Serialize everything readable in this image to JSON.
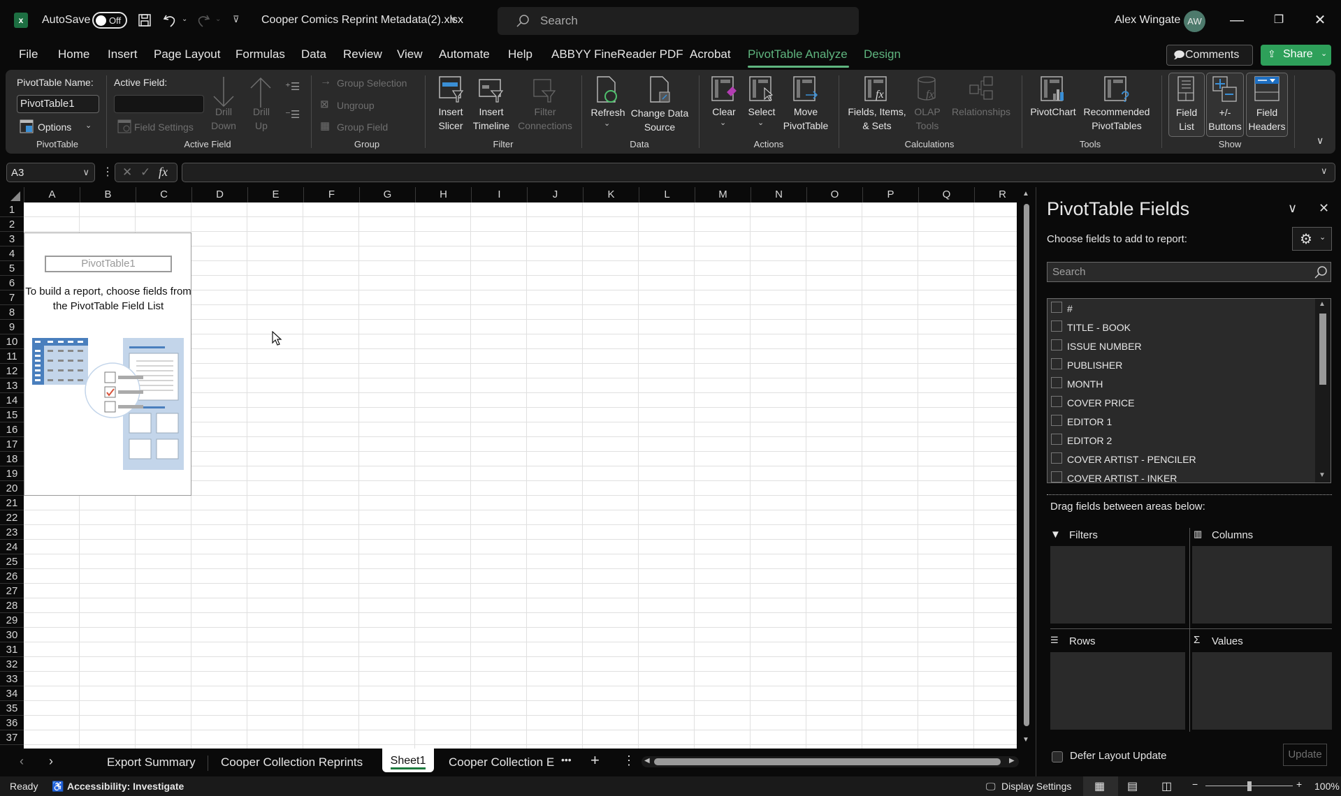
{
  "titlebar": {
    "app_icon": "excel-icon",
    "autosave_label": "AutoSave",
    "autosave_state": "Off",
    "filename": "Cooper Comics Reprint Metadata(2).xlsx",
    "search_placeholder": "Search",
    "user_name": "Alex Wingate",
    "user_initials": "AW"
  },
  "menu_tabs": [
    {
      "label": "File"
    },
    {
      "label": "Home"
    },
    {
      "label": "Insert"
    },
    {
      "label": "Page Layout"
    },
    {
      "label": "Formulas"
    },
    {
      "label": "Data"
    },
    {
      "label": "Review"
    },
    {
      "label": "View"
    },
    {
      "label": "Automate"
    },
    {
      "label": "Help"
    },
    {
      "label": "ABBYY FineReader PDF"
    },
    {
      "label": "Acrobat"
    },
    {
      "label": "PivotTable Analyze",
      "active": true
    },
    {
      "label": "Design"
    }
  ],
  "header_buttons": {
    "comments": "Comments",
    "share": "Share"
  },
  "ribbon": {
    "pivottable": {
      "name_label": "PivotTable Name:",
      "name_value": "PivotTable1",
      "options": "Options",
      "group": "PivotTable"
    },
    "active_field": {
      "label": "Active Field:",
      "value": "",
      "field_settings": "Field Settings",
      "drill_down": [
        "Drill",
        "Down"
      ],
      "drill_up": [
        "Drill",
        "Up"
      ],
      "group": "Active Field"
    },
    "group": {
      "group_selection": "Group Selection",
      "ungroup": "Ungroup",
      "group_field": "Group Field",
      "group": "Group"
    },
    "filter": {
      "insert_slicer": [
        "Insert",
        "Slicer"
      ],
      "insert_timeline": [
        "Insert",
        "Timeline"
      ],
      "filter_connections": [
        "Filter",
        "Connections"
      ],
      "group": "Filter"
    },
    "data": {
      "refresh": "Refresh",
      "change_data_source": [
        "Change Data",
        "Source"
      ],
      "group": "Data"
    },
    "actions": {
      "clear": "Clear",
      "select": "Select",
      "move_pivottable": [
        "Move",
        "PivotTable"
      ],
      "group": "Actions"
    },
    "calculations": {
      "fields_items_sets": [
        "Fields, Items,",
        "& Sets"
      ],
      "olap_tools": [
        "OLAP",
        "Tools"
      ],
      "relationships": "Relationships",
      "group": "Calculations"
    },
    "tools": {
      "pivotchart": "PivotChart",
      "recommended": [
        "Recommended",
        "PivotTables"
      ],
      "group": "Tools"
    },
    "show": {
      "field_list": [
        "Field",
        "List"
      ],
      "buttons": [
        "+/-",
        "Buttons"
      ],
      "field_headers": [
        "Field",
        "Headers"
      ],
      "group": "Show"
    }
  },
  "formula_bar": {
    "name_box": "A3",
    "formula": ""
  },
  "grid": {
    "columns": [
      "A",
      "B",
      "C",
      "D",
      "E",
      "F",
      "G",
      "H",
      "I",
      "J",
      "K",
      "L",
      "M",
      "N",
      "O",
      "P",
      "Q",
      "R"
    ],
    "rows": [
      "1",
      "2",
      "3",
      "4",
      "5",
      "6",
      "7",
      "8",
      "9",
      "10",
      "11",
      "12",
      "13",
      "14",
      "15",
      "16",
      "17",
      "18",
      "19",
      "20",
      "21",
      "22",
      "23",
      "24",
      "25",
      "26",
      "27",
      "28",
      "29",
      "30",
      "31",
      "32",
      "33",
      "34",
      "35",
      "36",
      "37"
    ]
  },
  "pivot_placeholder": {
    "title": "PivotTable1",
    "instruction": "To build a report, choose fields from the PivotTable Field List"
  },
  "sheet_tabs": [
    {
      "label": "Export Summary"
    },
    {
      "label": "Cooper Collection Reprints"
    },
    {
      "label": "Sheet1",
      "active": true
    },
    {
      "label": "Cooper Collection E"
    }
  ],
  "status_bar": {
    "ready": "Ready",
    "accessibility": "Accessibility: Investigate",
    "display_settings": "Display Settings",
    "zoom": "100%",
    "zoom_level_percent": 100
  },
  "pivot_panel": {
    "title": "PivotTable Fields",
    "subtitle": "Choose fields to add to report:",
    "search_placeholder": "Search",
    "fields": [
      {
        "name": "#",
        "checked": false
      },
      {
        "name": "TITLE - BOOK",
        "checked": false
      },
      {
        "name": "ISSUE NUMBER",
        "checked": false
      },
      {
        "name": "PUBLISHER",
        "checked": false
      },
      {
        "name": "MONTH",
        "checked": false
      },
      {
        "name": "COVER PRICE",
        "checked": false
      },
      {
        "name": "EDITOR 1",
        "checked": false
      },
      {
        "name": "EDITOR 2",
        "checked": false
      },
      {
        "name": "COVER ARTIST - PENCILER",
        "checked": false
      },
      {
        "name": "COVER ARTIST - INKER",
        "checked": false
      }
    ],
    "drag_label": "Drag fields between areas below:",
    "areas": {
      "filters": "Filters",
      "columns": "Columns",
      "rows": "Rows",
      "values": "Values"
    },
    "defer_label": "Defer Layout Update",
    "update_button": "Update"
  },
  "colors": {
    "accent_green": "#5fb57f",
    "share_green": "#2ea05a",
    "excel_green": "#1d6f42"
  }
}
